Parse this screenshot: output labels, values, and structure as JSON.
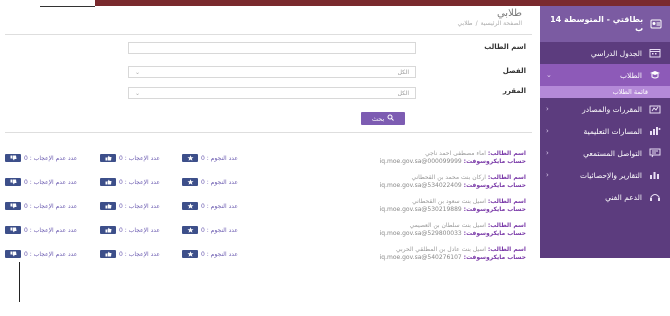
{
  "sidebar": {
    "header": {
      "label": "بطاقتي - المتوسطة 14 ب",
      "icon": "id-card-icon"
    },
    "items": [
      {
        "label": "الجدول الدراسي",
        "icon": "calendar-icon",
        "arrow": ""
      },
      {
        "label": "الطلاب",
        "icon": "students-icon",
        "arrow": "⌄"
      },
      {
        "label": "المقررات والمصادر",
        "icon": "books-icon",
        "arrow": "‹"
      },
      {
        "label": "المسارات التعليمية",
        "icon": "path-icon",
        "arrow": "‹"
      },
      {
        "label": "التواصل المستمعي",
        "icon": "chat-icon",
        "arrow": "‹"
      },
      {
        "label": "التقارير والإحصائيات",
        "icon": "chart-icon",
        "arrow": "‹"
      },
      {
        "label": "الدعم الفني",
        "icon": "headset-icon",
        "arrow": ""
      }
    ],
    "sub_item": "قائمة الطلاب"
  },
  "page": {
    "title": "طلابي",
    "breadcrumb": [
      "الصفحة الرئيسية",
      "طلابي"
    ]
  },
  "form": {
    "student_name_label": "اسم الطالب",
    "student_name_value": "",
    "class_label": "الفصل",
    "class_value": "الكل",
    "course_label": "المقرر",
    "course_value": "الكل",
    "search_button": "بحث",
    "search_icon": "search-icon"
  },
  "students": [
    {
      "name_label": "اسم الطالب:",
      "name": "اماء مصطفى احمد ناجي",
      "account_label": "حساب مايكروسوفت:",
      "account": "000099999@iq.moe.gov.sa",
      "stars_label": "عدد النجوم : 0",
      "likes_label": "عدد الإعجاب : 0",
      "dislikes_label": "عدد عدم الإعجاب : 0"
    },
    {
      "name_label": "اسم الطالب:",
      "name": "اركان بنت محمد بن القحطاني",
      "account_label": "حساب مايكروسوفت:",
      "account": "534022409@iq.moe.gov.sa",
      "stars_label": "عدد النجوم : 0",
      "likes_label": "عدد الإعجاب : 0",
      "dislikes_label": "عدد عدم الإعجاب : 0"
    },
    {
      "name_label": "اسم الطالب:",
      "name": "اسيل بنت سعود بن القحطاني",
      "account_label": "حساب مايكروسوفت:",
      "account": "530219889@iq.moe.gov.sa",
      "stars_label": "عدد النجوم : 0",
      "likes_label": "عدد الإعجاب : 0",
      "dislikes_label": "عدد عدم الإعجاب : 0"
    },
    {
      "name_label": "اسم الطالب:",
      "name": "اسيل بنت سلطان بن العصيمي",
      "account_label": "حساب مايكروسوفت:",
      "account": "529800033@iq.moe.gov.sa",
      "stars_label": "عدد النجوم : 0",
      "likes_label": "عدد الإعجاب : 0",
      "dislikes_label": "عدد عدم الإعجاب : 0"
    },
    {
      "name_label": "اسم الطالب:",
      "name": "اسيل بنت عادل بن المطلقي الحربي",
      "account_label": "حساب مايكروسوفت:",
      "account": "540276107@iq.moe.gov.sa",
      "stars_label": "عدد النجوم : 0",
      "likes_label": "عدد الإعجاب : 0",
      "dislikes_label": "عدد عدم الإعجاب : 0"
    }
  ],
  "colors": {
    "sidebar_bg": "#5c3c7e",
    "sidebar_active": "#8d5ab8",
    "accent": "#7d5cb2",
    "top_bar": "#7a2a2e"
  }
}
